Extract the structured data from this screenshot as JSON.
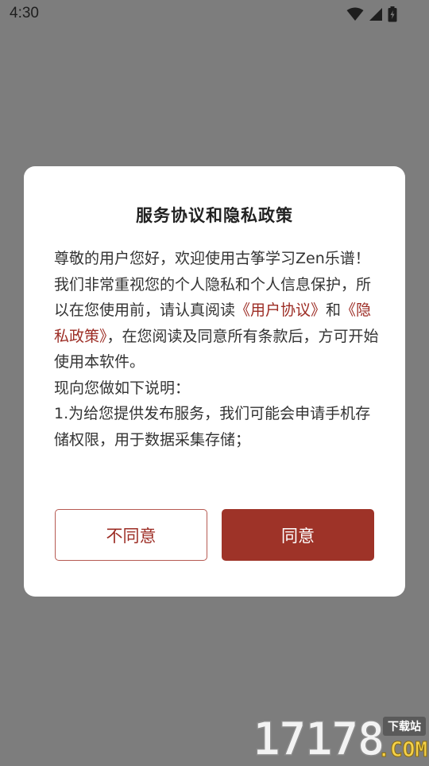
{
  "status_bar": {
    "time": "4:30",
    "icons": [
      "wifi-icon",
      "signal-icon",
      "battery-icon"
    ]
  },
  "dialog": {
    "title": "服务协议和隐私政策",
    "paragraph1_part1": "尊敬的用户您好，欢迎使用古筝学习Zen乐谱！我们非常重视您的个人隐私和个人信息保护，所以在您使用前，请认真阅读",
    "user_agreement_link": "《用户协议》",
    "and_text": "和",
    "privacy_policy_link": "《隐私政策》",
    "paragraph1_part2": "，在您阅读及同意所有条款后，方可开始使用本软件。",
    "paragraph2": "现向您做如下说明：",
    "paragraph3": "1.为给您提供发布服务，我们可能会申请手机存储权限，用于数据采集存储；",
    "disagree_label": "不同意",
    "agree_label": "同意"
  },
  "watermark": {
    "number": "17178",
    "site_label": "下载站",
    "domain": ".COM"
  },
  "colors": {
    "overlay": "#7d7d7d",
    "accent": "#9e3328",
    "link": "#9c2c24"
  }
}
